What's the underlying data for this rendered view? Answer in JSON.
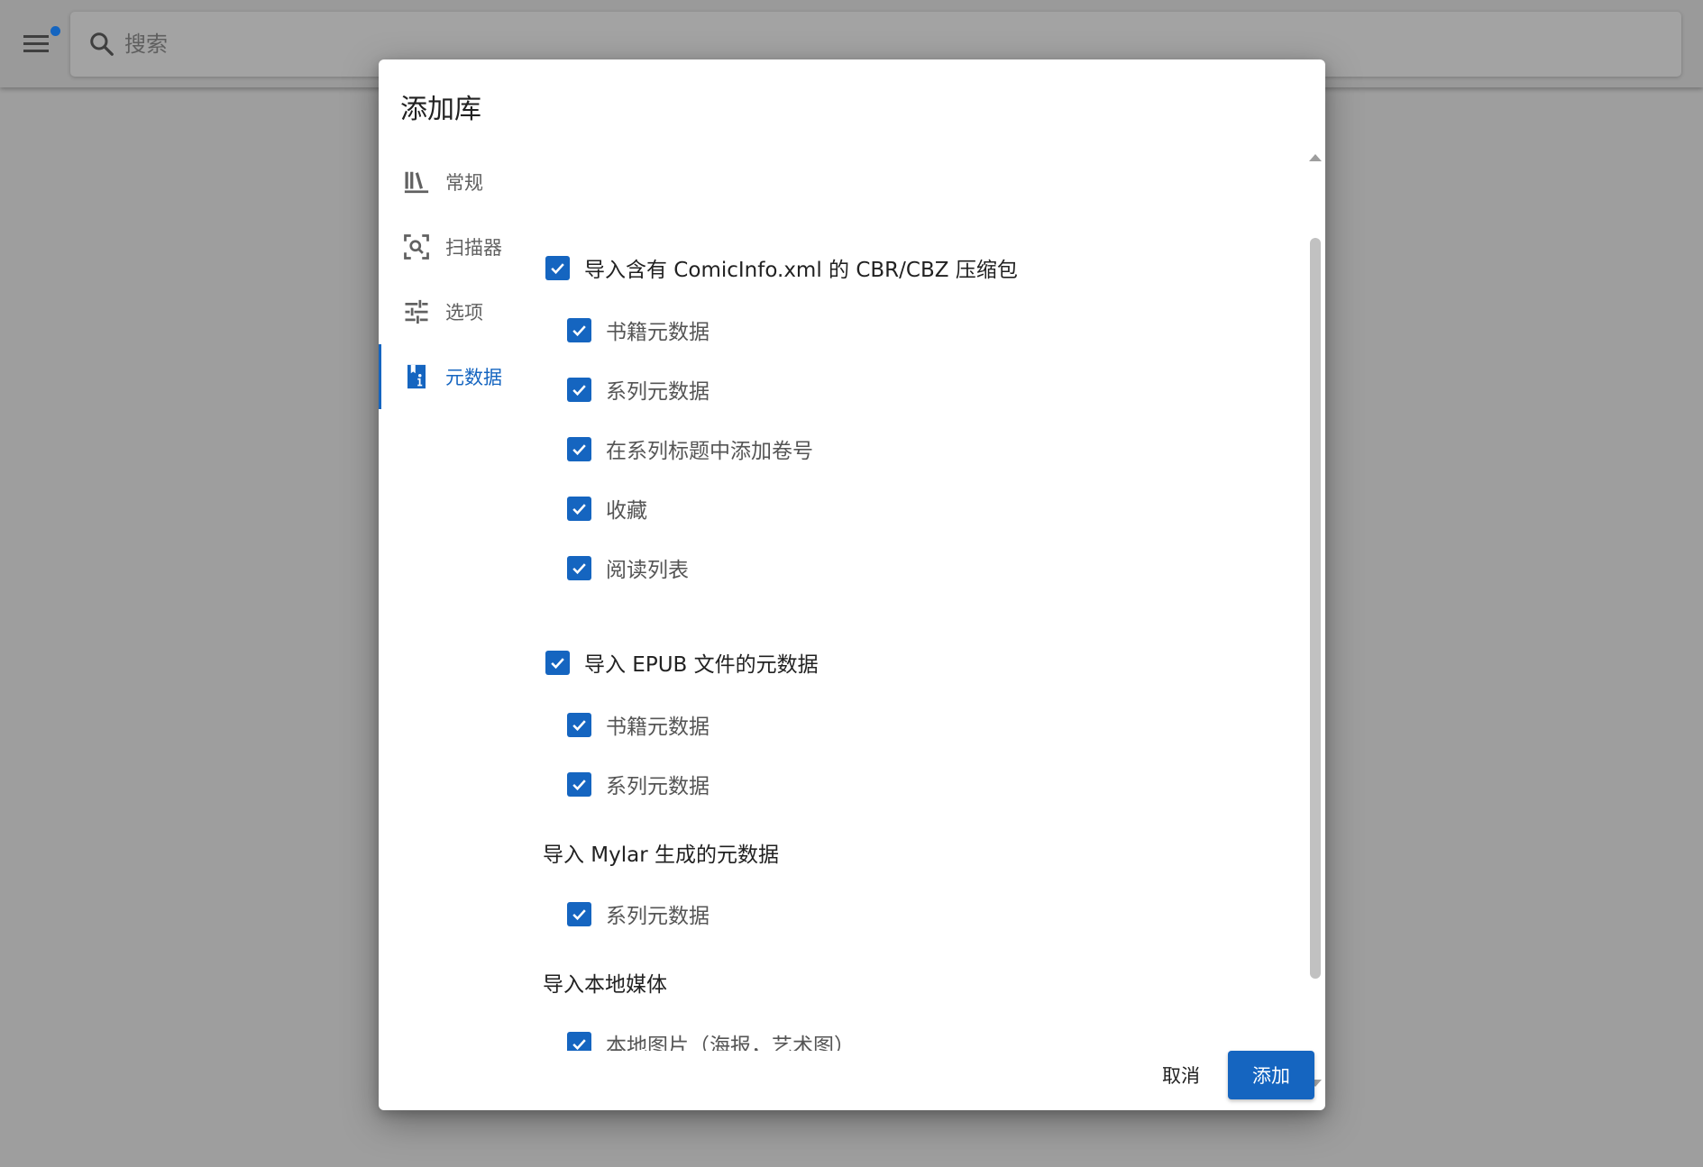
{
  "app": {
    "search_placeholder": "搜索"
  },
  "dialog": {
    "title": "添加库",
    "nav": [
      {
        "label": "常规",
        "icon": "bookshelf-icon",
        "active": false
      },
      {
        "label": "扫描器",
        "icon": "scan-icon",
        "active": false
      },
      {
        "label": "选项",
        "icon": "tune-sliders-icon",
        "active": false
      },
      {
        "label": "元数据",
        "icon": "book-info-icon",
        "active": true
      }
    ],
    "sections": {
      "comicinfo": {
        "label": "导入含有 ComicInfo.xml 的 CBR/CBZ 压缩包",
        "checked": true,
        "items": [
          {
            "label": "书籍元数据",
            "checked": true
          },
          {
            "label": "系列元数据",
            "checked": true
          },
          {
            "label": "在系列标题中添加卷号",
            "checked": true
          },
          {
            "label": "收藏",
            "checked": true
          },
          {
            "label": "阅读列表",
            "checked": true
          }
        ]
      },
      "epub": {
        "label": "导入 EPUB 文件的元数据",
        "checked": true,
        "items": [
          {
            "label": "书籍元数据",
            "checked": true
          },
          {
            "label": "系列元数据",
            "checked": true
          }
        ]
      },
      "mylar": {
        "heading": "导入 Mylar 生成的元数据",
        "items": [
          {
            "label": "系列元数据",
            "checked": true
          }
        ]
      },
      "local": {
        "heading": "导入本地媒体",
        "items": [
          {
            "label": "本地图片（海报，艺术图）",
            "checked": true
          }
        ]
      }
    },
    "buttons": {
      "cancel": "取消",
      "add": "添加"
    }
  },
  "colors": {
    "accent": "#1565c0",
    "overlay": "#9e9e9e",
    "dialog_bg": "#ffffff"
  }
}
